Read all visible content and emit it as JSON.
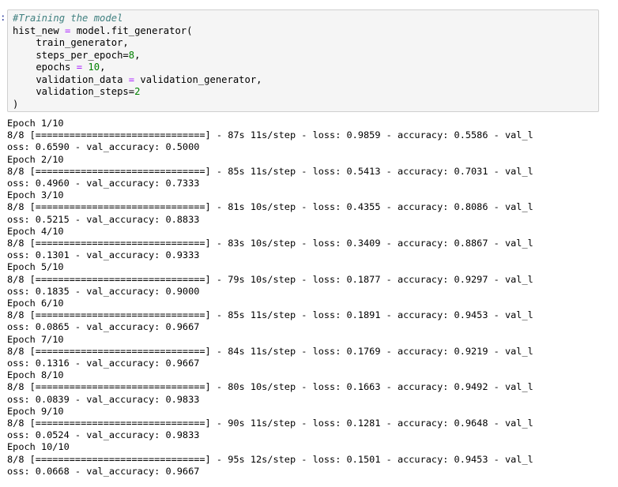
{
  "prompt": ":",
  "code": {
    "comment": "#Training the model",
    "line1_var": "hist_new",
    "line1_assign": " = ",
    "line1_call": "model.fit_generator(",
    "arg1": "    train_generator,",
    "arg2_name": "    steps_per_epoch=",
    "arg2_val": "8",
    "arg2_end": ",",
    "arg3_name": "    epochs ",
    "arg3_eq": "=",
    "arg3_sp": " ",
    "arg3_val": "10",
    "arg3_end": ",",
    "arg4_name": "    validation_data ",
    "arg4_eq": "=",
    "arg4_val": " validation_generator,",
    "arg5_name": "    validation_steps=",
    "arg5_val": "2",
    "close": ")"
  },
  "output_lines": [
    "Epoch 1/10",
    "8/8 [==============================] - 87s 11s/step - loss: 0.9859 - accuracy: 0.5586 - val_l",
    "oss: 0.6590 - val_accuracy: 0.5000",
    "Epoch 2/10",
    "8/8 [==============================] - 85s 11s/step - loss: 0.5413 - accuracy: 0.7031 - val_l",
    "oss: 0.4960 - val_accuracy: 0.7333",
    "Epoch 3/10",
    "8/8 [==============================] - 81s 10s/step - loss: 0.4355 - accuracy: 0.8086 - val_l",
    "oss: 0.5215 - val_accuracy: 0.8833",
    "Epoch 4/10",
    "8/8 [==============================] - 83s 10s/step - loss: 0.3409 - accuracy: 0.8867 - val_l",
    "oss: 0.1301 - val_accuracy: 0.9333",
    "Epoch 5/10",
    "8/8 [==============================] - 79s 10s/step - loss: 0.1877 - accuracy: 0.9297 - val_l",
    "oss: 0.1835 - val_accuracy: 0.9000",
    "Epoch 6/10",
    "8/8 [==============================] - 85s 11s/step - loss: 0.1891 - accuracy: 0.9453 - val_l",
    "oss: 0.0865 - val_accuracy: 0.9667",
    "Epoch 7/10",
    "8/8 [==============================] - 84s 11s/step - loss: 0.1769 - accuracy: 0.9219 - val_l",
    "oss: 0.1316 - val_accuracy: 0.9667",
    "Epoch 8/10",
    "8/8 [==============================] - 80s 10s/step - loss: 0.1663 - accuracy: 0.9492 - val_l",
    "oss: 0.0839 - val_accuracy: 0.9833",
    "Epoch 9/10",
    "8/8 [==============================] - 90s 11s/step - loss: 0.1281 - accuracy: 0.9648 - val_l",
    "oss: 0.0524 - val_accuracy: 0.9833",
    "Epoch 10/10",
    "8/8 [==============================] - 95s 12s/step - loss: 0.1501 - accuracy: 0.9453 - val_l",
    "oss: 0.0668 - val_accuracy: 0.9667"
  ]
}
